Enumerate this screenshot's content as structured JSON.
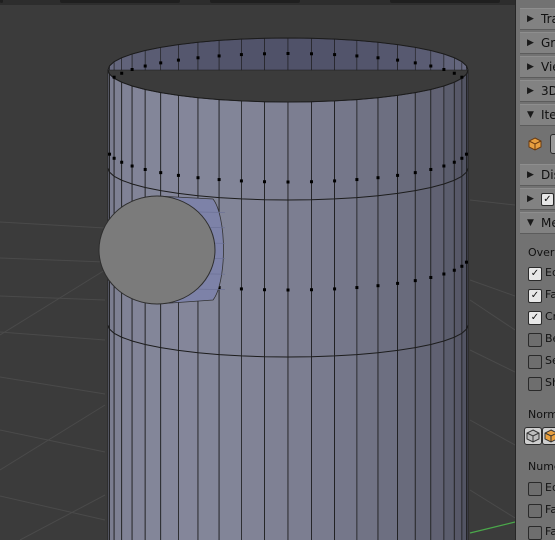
{
  "panel": {
    "headers": [
      {
        "label": "Tra",
        "expanded": false
      },
      {
        "label": "Gre",
        "expanded": false
      },
      {
        "label": "Vie",
        "expanded": false
      },
      {
        "label": "3D",
        "expanded": false
      },
      {
        "label": "Ite",
        "expanded": true
      },
      {
        "label": "Dis",
        "expanded": false
      },
      {
        "label": "",
        "expanded": false,
        "checkbox": true
      },
      {
        "label": "Me",
        "expanded": true
      }
    ],
    "overlays_label": "Overl",
    "overlay_options": [
      {
        "label": "Ed",
        "checked": true
      },
      {
        "label": "Fa",
        "checked": true
      },
      {
        "label": "Cr",
        "checked": true
      },
      {
        "label": "Be",
        "checked": false
      },
      {
        "label": "Se",
        "checked": false
      },
      {
        "label": "Sh",
        "checked": false
      }
    ],
    "normals_label": "Norm",
    "numerics_label": "Nume",
    "numeric_options": [
      {
        "label": "Ed",
        "checked": false
      },
      {
        "label": "Fa",
        "checked": false
      },
      {
        "label": "Fa",
        "checked": false
      }
    ]
  },
  "colors": {
    "viewport_bg": "#3b3b3b",
    "mesh_face": "#8c8f99",
    "mesh_dark": "#5d6070",
    "edge": "#1c1c1c",
    "cylinder_face": "#7b7b7b",
    "cylinder_side": "#7d82a8"
  }
}
